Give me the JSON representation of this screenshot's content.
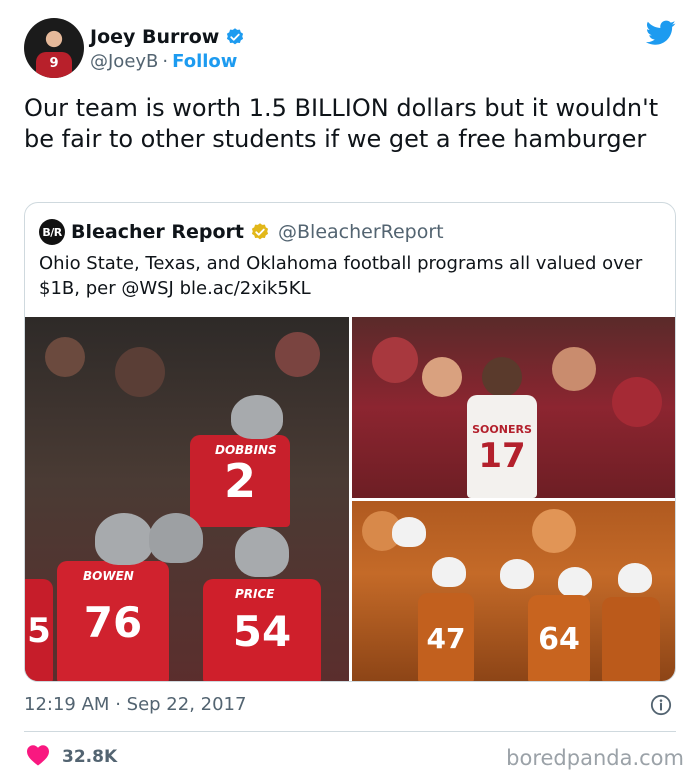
{
  "author": {
    "display_name": "Joey Burrow",
    "handle": "@JoeyB",
    "separator": "·",
    "follow_label": "Follow",
    "avatar_jersey_number": "9",
    "avatar_icon": "avatar-photo",
    "verified_icon": "verified-badge-icon"
  },
  "brand_icon": "twitter-bird-icon",
  "tweet_text": "Our team is worth 1.5 BILLION dollars but it wouldn't be fair to other students if we get a free hamburger",
  "quoted_tweet": {
    "logo_text": "B/R",
    "display_name": "Bleacher Report",
    "handle": "@BleacherReport",
    "text": "Ohio State, Texas, and Oklahoma football programs all valued over $1B, per @WSJ ble.ac/2xik5KL",
    "media": {
      "left": {
        "jersey_names": [
          "DOBBINS",
          "BOWEN",
          "PRICE"
        ],
        "jersey_numbers": [
          "2",
          "76",
          "54",
          "5"
        ]
      },
      "top_right": {
        "jersey_name": "SOONERS",
        "jersey_number": "17"
      },
      "bottom_right": {
        "jersey_numbers": [
          "64",
          "47"
        ]
      }
    }
  },
  "timestamp": {
    "time": "12:19 AM",
    "separator": "·",
    "date": "Sep 22, 2017"
  },
  "engagement": {
    "likes": "32.8K",
    "like_icon": "heart-icon"
  },
  "watermark": "boredpanda.com",
  "colors": {
    "accent": "#1d9bf0",
    "heart": "#f91880",
    "text_primary": "#0f1419",
    "text_secondary": "#536471",
    "gold_badge": "#e2b719",
    "border": "#cfd9de"
  }
}
